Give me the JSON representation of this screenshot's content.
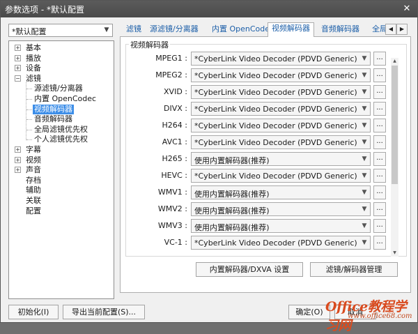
{
  "window": {
    "title": "参数选项 - *默认配置",
    "close_glyph": "✕"
  },
  "preset": {
    "value": "*默认配置"
  },
  "tree": {
    "items": [
      {
        "label": "基本",
        "expander": "+"
      },
      {
        "label": "播放",
        "expander": "+"
      },
      {
        "label": "设备",
        "expander": "+"
      },
      {
        "label": "滤镜",
        "expander": "−"
      },
      {
        "label": "源滤镜/分离器"
      },
      {
        "label": "内置 OpenCodec"
      },
      {
        "label": "视频解码器"
      },
      {
        "label": "音频解码器"
      },
      {
        "label": "全局滤镜优先权"
      },
      {
        "label": "个人滤镜优先权"
      },
      {
        "label": "字幕",
        "expander": "+"
      },
      {
        "label": "视频",
        "expander": "+"
      },
      {
        "label": "声音",
        "expander": "+"
      },
      {
        "label": "存档"
      },
      {
        "label": "辅助"
      },
      {
        "label": "关联"
      },
      {
        "label": "配置"
      }
    ]
  },
  "tabs": [
    "滤镜",
    "源滤镜/分离器",
    "内置 OpenCodec",
    "视频解码器",
    "音频解码器",
    "全局滤"
  ],
  "tab_nav": {
    "left": "◀",
    "right": "▶"
  },
  "panel": {
    "group_label": "视频解码器",
    "decoders": [
      {
        "label": "MPEG1 :",
        "value": "*CyberLink Video Decoder (PDVD Generic)"
      },
      {
        "label": "MPEG2 :",
        "value": "*CyberLink Video Decoder (PDVD Generic)"
      },
      {
        "label": "XVID :",
        "value": "*CyberLink Video Decoder (PDVD Generic)"
      },
      {
        "label": "DIVX :",
        "value": "*CyberLink Video Decoder (PDVD Generic)"
      },
      {
        "label": "H264 :",
        "value": "*CyberLink Video Decoder (PDVD Generic)"
      },
      {
        "label": "AVC1 :",
        "value": "*CyberLink Video Decoder (PDVD Generic)"
      },
      {
        "label": "H265 :",
        "value": "使用内置解码器(推荐)"
      },
      {
        "label": "HEVC :",
        "value": "*CyberLink Video Decoder (PDVD Generic)"
      },
      {
        "label": "WMV1 :",
        "value": "使用内置解码器(推荐)"
      },
      {
        "label": "WMV2 :",
        "value": "使用内置解码器(推荐)"
      },
      {
        "label": "WMV3 :",
        "value": "使用内置解码器(推荐)"
      },
      {
        "label": "VC-1 :",
        "value": "*CyberLink Video Decoder (PDVD Generic)"
      }
    ],
    "more_label": "...",
    "builtin_button": "内置解码器/DXVA 设置",
    "manage_button": "滤镜/解码器管理"
  },
  "bottom": {
    "init_button": "初始化(I)",
    "export_button": "导出当前配置(S)...",
    "ok_button": "确定(O)",
    "cancel_button": "取消"
  },
  "watermark": {
    "line1": "Office教程学习网",
    "line2": "www.office68.com"
  }
}
